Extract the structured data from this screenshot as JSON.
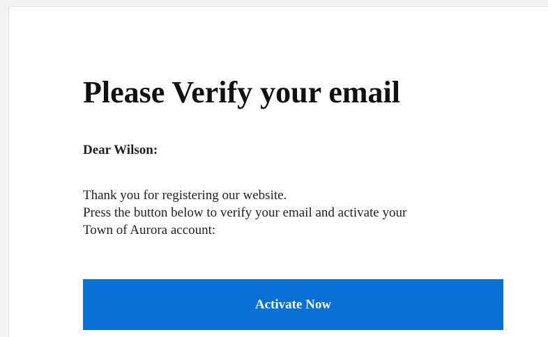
{
  "email": {
    "title": "Please Verify your email",
    "greeting": "Dear Wilson:",
    "body_lines": [
      "Thank you for registering our website.",
      "Press the button below to verify your email and activate your",
      "Town of Aurora account:"
    ],
    "button_label": "Activate Now"
  },
  "colors": {
    "button_background": "#0771d8",
    "button_text": "#ffffff",
    "page_background": "#f3f3f3",
    "card_background": "#ffffff"
  }
}
